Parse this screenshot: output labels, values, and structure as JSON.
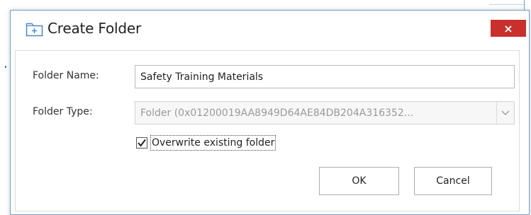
{
  "dialog": {
    "title": "Create Folder",
    "title_icon": "folder-icon",
    "close_icon": "close-icon",
    "close_glyph": "×"
  },
  "form": {
    "folder_name_label": "Folder Name:",
    "folder_name_value": "Safety Training Materials",
    "folder_type_label": "Folder Type:",
    "folder_type_value": "Folder (0x01200019AA8949D64AE84DB204A316352...",
    "overwrite_label": "Overwrite existing folder",
    "overwrite_checked": true
  },
  "buttons": {
    "ok_label": "OK",
    "cancel_label": "Cancel"
  },
  "colors": {
    "close_button": "#c9302c",
    "dialog_border": "#7d9ec2",
    "icon_blue": "#4a86c8"
  }
}
